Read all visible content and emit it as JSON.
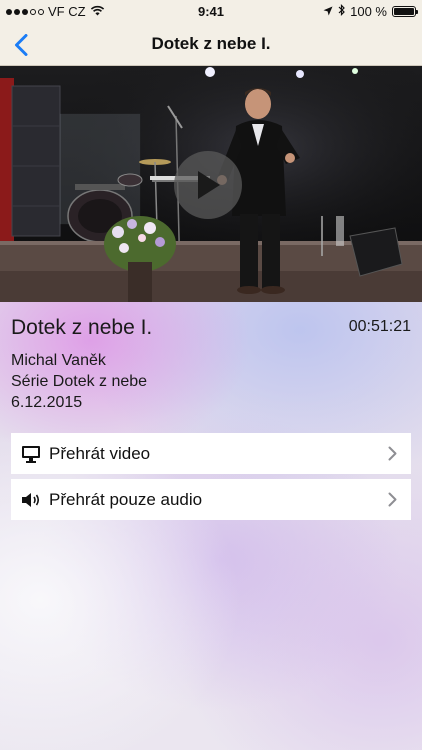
{
  "status_bar": {
    "carrier": "VF CZ",
    "time": "9:41",
    "battery": "100 %"
  },
  "nav": {
    "title": "Dotek z nebe I."
  },
  "sermon": {
    "title": "Dotek z nebe I.",
    "duration": "00:51:21",
    "author": "Michal Vaněk",
    "series": "Série Dotek z nebe",
    "date": "6.12.2015"
  },
  "actions": {
    "play_video": "Přehrát video",
    "play_audio": "Přehrát pouze audio"
  },
  "colors": {
    "accent": "#1a7cf6",
    "nav_bg": "#f3efe6"
  }
}
